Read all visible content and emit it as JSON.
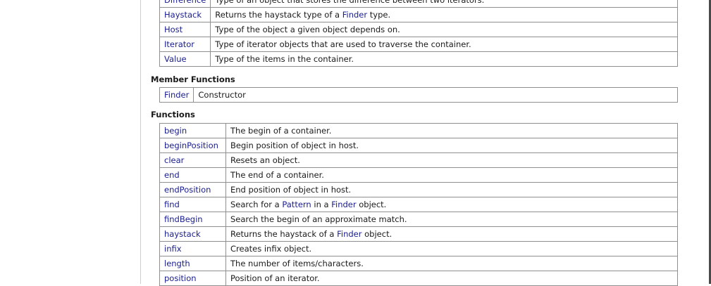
{
  "types": [
    {
      "name": "Difference",
      "desc": "Type of an object that stores the difference between two iterators."
    },
    {
      "name": "Haystack",
      "desc_pre": "Returns the haystack type of a ",
      "desc_link": "Finder",
      "desc_post": " type."
    },
    {
      "name": "Host",
      "desc": "Type of the object a given object depends on."
    },
    {
      "name": "Iterator",
      "desc": "Type of iterator objects that are used to traverse the container."
    },
    {
      "name": "Value",
      "desc": "Type of the items in the container."
    }
  ],
  "member_functions": {
    "heading": "Member Functions",
    "rows": [
      {
        "name": "Finder",
        "desc": "Constructor"
      }
    ]
  },
  "functions": {
    "heading": "Functions",
    "rows": [
      {
        "name": "begin",
        "desc": "The begin of a container."
      },
      {
        "name": "beginPosition",
        "desc": "Begin position of object in host."
      },
      {
        "name": "clear",
        "desc": "Resets an object."
      },
      {
        "name": "end",
        "desc": "The end of a container."
      },
      {
        "name": "endPosition",
        "desc": "End position of object in host."
      },
      {
        "name": "find",
        "desc_pre": "Search for a ",
        "desc_link": "Pattern",
        "desc_mid": " in a ",
        "desc_link2": "Finder",
        "desc_post": " object."
      },
      {
        "name": "findBegin",
        "desc": "Search the begin of an approximate match."
      },
      {
        "name": "haystack",
        "desc_pre": "Returns the haystack of a ",
        "desc_link": "Finder",
        "desc_post": " object."
      },
      {
        "name": "infix",
        "desc": "Creates infix object."
      },
      {
        "name": "length",
        "desc": "The number of items/characters."
      },
      {
        "name": "position",
        "desc": "Position of an iterator."
      }
    ]
  }
}
